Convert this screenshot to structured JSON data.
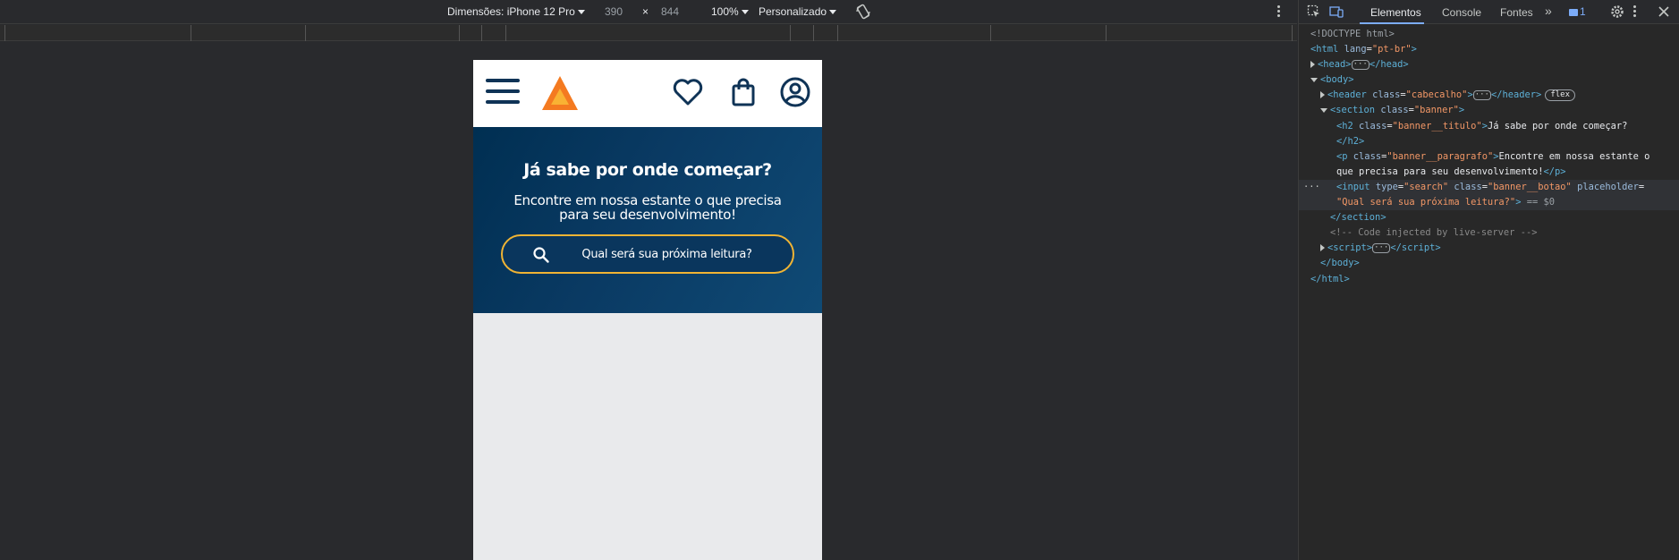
{
  "device_toolbar": {
    "dimensions_label": "Dimensões: iPhone 12 Pro",
    "width": "390",
    "times": "×",
    "height": "844",
    "zoom": "100%",
    "throttle": "Personalizado",
    "rotate_icon": "rotate-icon",
    "more_icon": "more-vert-icon"
  },
  "site": {
    "menu_icon": "hamburger-icon",
    "logo_icon": "triangle-logo-icon",
    "favorites_icon": "heart-icon",
    "bag_icon": "shopping-bag-icon",
    "profile_icon": "user-circle-icon",
    "banner": {
      "title": "Já sabe por onde começar?",
      "paragraph": "Encontre em nossa estante o que precisa para seu desenvolvimento!",
      "search_placeholder": "Qual será sua próxima leitura?"
    },
    "colors": {
      "navy": "#0f3356",
      "accent": "#f0b434",
      "logo_orange": "#f47a20",
      "banner_dark": "#002f52"
    }
  },
  "devtools": {
    "tabs": [
      "Elementos",
      "Console",
      "Fontes"
    ],
    "more_tabs": "»",
    "messages_count": "1",
    "dom": {
      "doctype": "<!DOCTYPE html>",
      "html_tag": "html",
      "lang_attr": "lang",
      "lang_val": "\"pt-br\"",
      "head_tag": "head",
      "body_tag": "body",
      "header_tag": "header",
      "class_attr": "class",
      "header_class": "\"cabecalho\"",
      "flex_badge": "flex",
      "section_tag": "section",
      "section_class": "\"banner\"",
      "h2_tag": "h2",
      "h2_class": "\"banner__titulo\"",
      "h2_text": "Já sabe por onde começar?",
      "p_tag": "p",
      "p_class": "\"banner__paragrafo\"",
      "p_text_1": "Encontre em nossa estante o",
      "p_text_2": "que precisa para seu desenvolvimento!",
      "input_tag": "input",
      "type_attr": "type",
      "input_type": "\"search\"",
      "input_class": "\"banner__botao\"",
      "placeholder_attr": "placeholder",
      "input_placeholder": "\"Qual será sua próxima leitura?\"",
      "selected_marker": "== $0",
      "comment": "<!-- Code injected by live-server -->",
      "script_tag": "script"
    }
  }
}
